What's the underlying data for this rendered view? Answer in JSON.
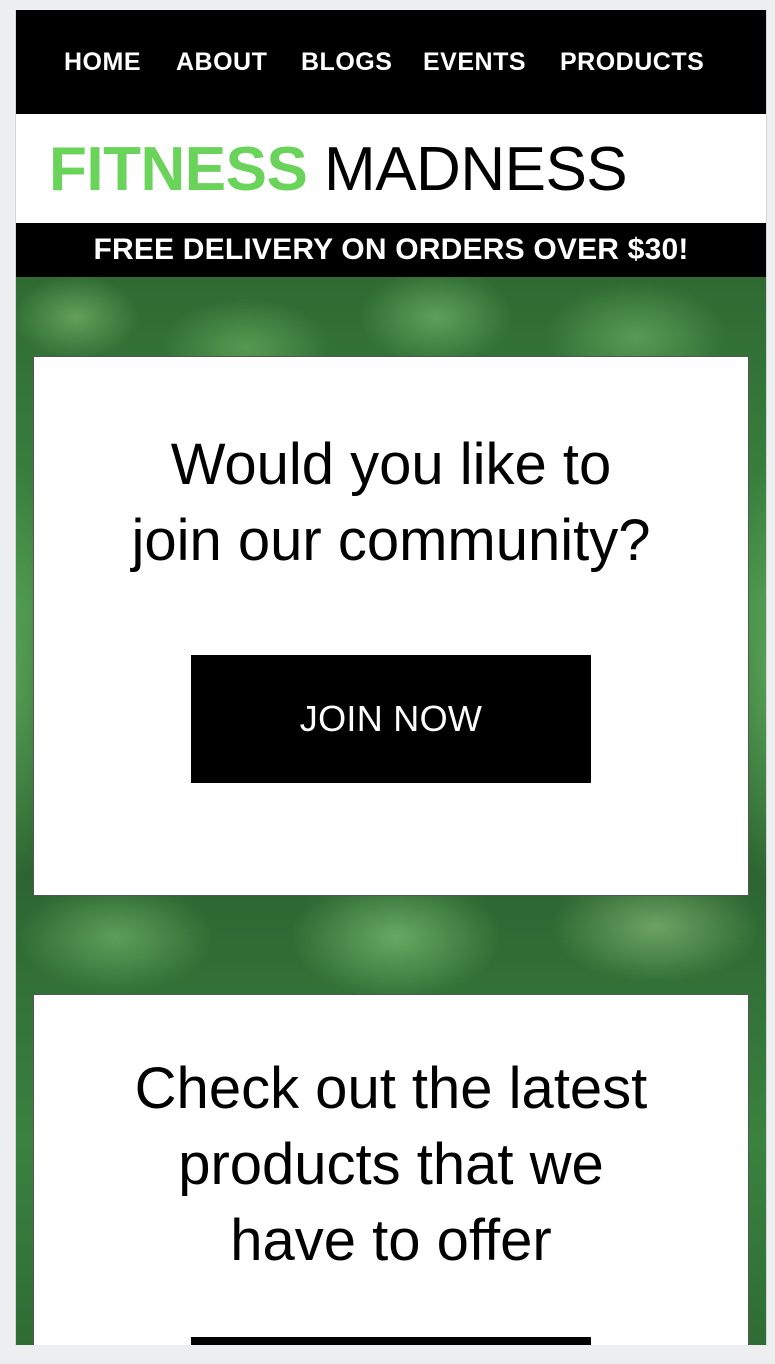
{
  "nav": {
    "items": [
      {
        "label": "HOME"
      },
      {
        "label": "ABOUT"
      },
      {
        "label": "BLOGS"
      },
      {
        "label": "EVENTS"
      },
      {
        "label": "PRODUCTS"
      }
    ]
  },
  "brand": {
    "word1": "FITNESS",
    "word2": "MADNESS",
    "accent_color": "#6ad45a"
  },
  "promo": {
    "text": "FREE DELIVERY ON ORDERS OVER $30!"
  },
  "community_card": {
    "heading_lines": [
      "Would you like to",
      "join our community?"
    ],
    "button_label": "JOIN NOW"
  },
  "products_card": {
    "heading_lines": [
      "Check out the latest",
      "products that we",
      "have to offer"
    ]
  },
  "colors": {
    "nav_background": "#000000",
    "hero_leaf_green": "#3e8a44",
    "button_background": "#000000"
  }
}
